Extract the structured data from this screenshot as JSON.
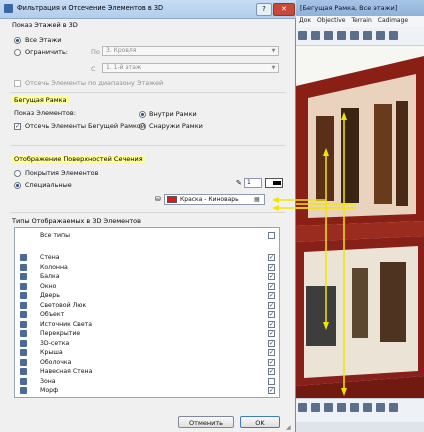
{
  "dialog": {
    "title": "Фильтрация и Отсечение Элементов в 3D",
    "help_label": "?",
    "close_label": "✕"
  },
  "storeys": {
    "heading": "Показ Этажей в 3D",
    "all_label": "Все Этажи",
    "limit_label": "Ограничить:",
    "to_label": "По",
    "from_label": "С",
    "to_value": "3. Кровля",
    "from_value": "1. 1-й этаж",
    "cut_label": "Отсечь Элементы по диапазону Этажей"
  },
  "marquee": {
    "heading": "Бегущая Рамка",
    "show_label": "Показ Элементов:",
    "inside_label": "Внутри Рамки",
    "outside_label": "Снаружи Рамки",
    "cut_label": "Отсечь Элементы Бегущей Рамкой"
  },
  "cut_surfaces": {
    "heading": "Отображение Поверхностей Сечения",
    "own_materials_label": "Покрытия Элементов",
    "special_label": "Специальные",
    "pen_value": "1",
    "material_value": "Краска - Киноварь"
  },
  "types": {
    "heading": "Типы Отображаемых в 3D Элементов",
    "all_label": "Все типы",
    "items": [
      {
        "label": "Стена",
        "icon": "wall-icon",
        "checked": "✓"
      },
      {
        "label": "Колонна",
        "icon": "column-icon",
        "checked": "✓"
      },
      {
        "label": "Балка",
        "icon": "beam-icon",
        "checked": "✓"
      },
      {
        "label": "Окно",
        "icon": "window-icon",
        "checked": "✓"
      },
      {
        "label": "Дверь",
        "icon": "door-icon",
        "checked": "✓"
      },
      {
        "label": "Световой Люк",
        "icon": "skylight-icon",
        "checked": "✓"
      },
      {
        "label": "Объект",
        "icon": "object-icon",
        "checked": "✓"
      },
      {
        "label": "Источник Света",
        "icon": "lamp-icon",
        "checked": "✓"
      },
      {
        "label": "Перекрытие",
        "icon": "slab-icon",
        "checked": "✓"
      },
      {
        "label": "3D-сетка",
        "icon": "mesh-icon",
        "checked": "✓"
      },
      {
        "label": "Крыша",
        "icon": "roof-icon",
        "checked": "✓"
      },
      {
        "label": "Оболочка",
        "icon": "shell-icon",
        "checked": "✓"
      },
      {
        "label": "Навесная Стена",
        "icon": "curtain-wall-icon",
        "checked": "✓"
      },
      {
        "label": "Зона",
        "icon": "zone-icon",
        "checked": ""
      },
      {
        "label": "Морф",
        "icon": "morph-icon",
        "checked": "✓"
      }
    ]
  },
  "buttons": {
    "cancel": "Отменить",
    "ok": "OK"
  },
  "background_app": {
    "title": "[Бегущая Рамка, Все этажи]",
    "menu": [
      "Док",
      "Objective",
      "Terrain",
      "Cadimage"
    ]
  },
  "colors": {
    "highlight": "#ffff9e",
    "material_swatch": "#e01a1a",
    "arrow_yellow": "#f2e600"
  }
}
